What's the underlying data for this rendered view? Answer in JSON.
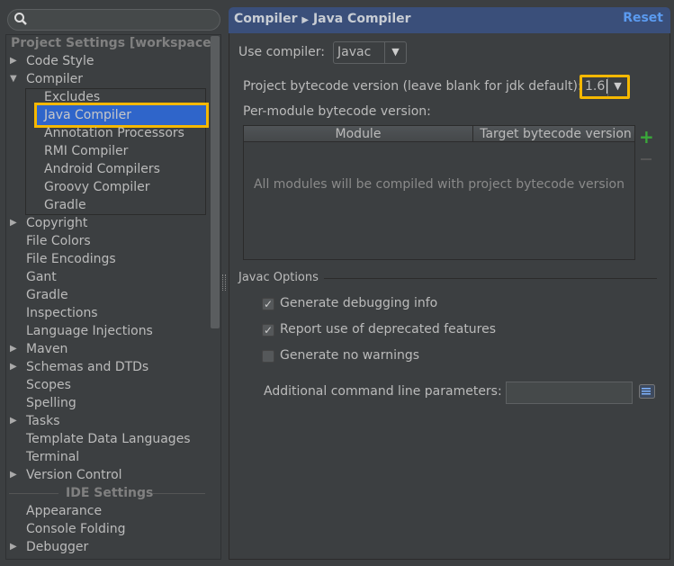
{
  "search": {
    "placeholder": ""
  },
  "tree": {
    "project_header": "Project Settings [workspace]",
    "items": [
      "Code Style",
      "Compiler",
      "Copyright",
      "File Colors",
      "File Encodings",
      "Gant",
      "Gradle",
      "Inspections",
      "Language Injections",
      "Maven",
      "Schemas and DTDs",
      "Scopes",
      "Spelling",
      "Tasks",
      "Template Data Languages",
      "Terminal",
      "Version Control"
    ],
    "compiler_children": [
      "Excludes",
      "Java Compiler",
      "Annotation Processors",
      "RMI Compiler",
      "Android Compilers",
      "Groovy Compiler",
      "Gradle"
    ],
    "ide_header": "IDE Settings",
    "ide_items": [
      "Appearance",
      "Console Folding",
      "Debugger"
    ]
  },
  "header": {
    "crumb1": "Compiler",
    "crumb2": "Java Compiler",
    "reset": "Reset"
  },
  "form": {
    "use_compiler_label": "Use compiler:",
    "use_compiler_value": "Javac",
    "bytecode_label": "Project bytecode version (leave blank for jdk default):",
    "bytecode_value": "1.6",
    "per_module_label": "Per-module bytecode version:",
    "table": {
      "columns": [
        "Module",
        "Target bytecode version"
      ],
      "empty_text": "All modules will be compiled with project bytecode version"
    },
    "javac_section": "Javac Options",
    "options": [
      {
        "label": "Generate debugging info",
        "checked": true
      },
      {
        "label": "Report use of deprecated features",
        "checked": true
      },
      {
        "label": "Generate no warnings",
        "checked": false
      }
    ],
    "params_label": "Additional command line parameters:",
    "params_value": ""
  }
}
